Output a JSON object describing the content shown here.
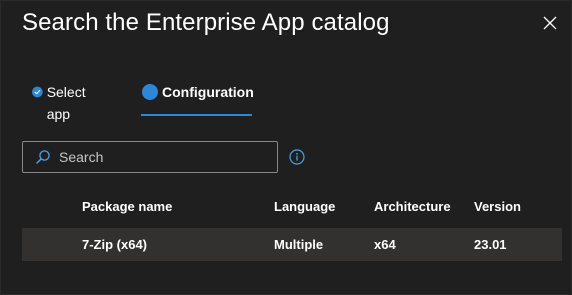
{
  "dialog": {
    "title": "Search the Enterprise App catalog"
  },
  "tabs": [
    {
      "label": "Select app",
      "state": "completed"
    },
    {
      "label": "Configuration",
      "state": "active"
    }
  ],
  "search": {
    "placeholder": "Search",
    "value": ""
  },
  "table": {
    "columns": [
      "Package name",
      "Language",
      "Architecture",
      "Version"
    ],
    "rows": [
      [
        "7-Zip (x64)",
        "Multiple",
        "x64",
        "23.01"
      ]
    ]
  },
  "icons": {
    "close": "close-icon",
    "completed": "checkmark-circle-icon",
    "active": "filled-circle-icon",
    "search": "search-icon",
    "info": "info-icon"
  },
  "colors": {
    "accent": "#2b88d8",
    "background": "#1f1f1f",
    "row_selected": "#323130"
  }
}
